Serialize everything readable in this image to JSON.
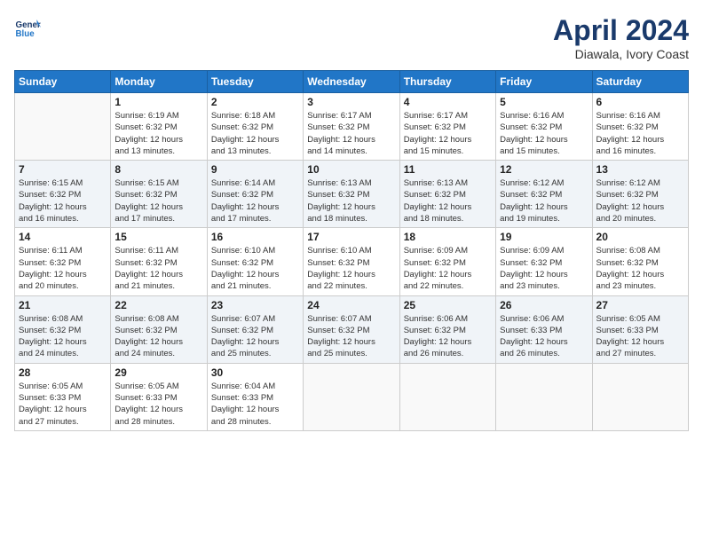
{
  "header": {
    "logo_line1": "General",
    "logo_line2": "Blue",
    "month": "April 2024",
    "location": "Diawala, Ivory Coast"
  },
  "weekdays": [
    "Sunday",
    "Monday",
    "Tuesday",
    "Wednesday",
    "Thursday",
    "Friday",
    "Saturday"
  ],
  "weeks": [
    [
      {
        "day": "",
        "info": ""
      },
      {
        "day": "1",
        "info": "Sunrise: 6:19 AM\nSunset: 6:32 PM\nDaylight: 12 hours\nand 13 minutes."
      },
      {
        "day": "2",
        "info": "Sunrise: 6:18 AM\nSunset: 6:32 PM\nDaylight: 12 hours\nand 13 minutes."
      },
      {
        "day": "3",
        "info": "Sunrise: 6:17 AM\nSunset: 6:32 PM\nDaylight: 12 hours\nand 14 minutes."
      },
      {
        "day": "4",
        "info": "Sunrise: 6:17 AM\nSunset: 6:32 PM\nDaylight: 12 hours\nand 15 minutes."
      },
      {
        "day": "5",
        "info": "Sunrise: 6:16 AM\nSunset: 6:32 PM\nDaylight: 12 hours\nand 15 minutes."
      },
      {
        "day": "6",
        "info": "Sunrise: 6:16 AM\nSunset: 6:32 PM\nDaylight: 12 hours\nand 16 minutes."
      }
    ],
    [
      {
        "day": "7",
        "info": "Sunrise: 6:15 AM\nSunset: 6:32 PM\nDaylight: 12 hours\nand 16 minutes."
      },
      {
        "day": "8",
        "info": "Sunrise: 6:15 AM\nSunset: 6:32 PM\nDaylight: 12 hours\nand 17 minutes."
      },
      {
        "day": "9",
        "info": "Sunrise: 6:14 AM\nSunset: 6:32 PM\nDaylight: 12 hours\nand 17 minutes."
      },
      {
        "day": "10",
        "info": "Sunrise: 6:13 AM\nSunset: 6:32 PM\nDaylight: 12 hours\nand 18 minutes."
      },
      {
        "day": "11",
        "info": "Sunrise: 6:13 AM\nSunset: 6:32 PM\nDaylight: 12 hours\nand 18 minutes."
      },
      {
        "day": "12",
        "info": "Sunrise: 6:12 AM\nSunset: 6:32 PM\nDaylight: 12 hours\nand 19 minutes."
      },
      {
        "day": "13",
        "info": "Sunrise: 6:12 AM\nSunset: 6:32 PM\nDaylight: 12 hours\nand 20 minutes."
      }
    ],
    [
      {
        "day": "14",
        "info": "Sunrise: 6:11 AM\nSunset: 6:32 PM\nDaylight: 12 hours\nand 20 minutes."
      },
      {
        "day": "15",
        "info": "Sunrise: 6:11 AM\nSunset: 6:32 PM\nDaylight: 12 hours\nand 21 minutes."
      },
      {
        "day": "16",
        "info": "Sunrise: 6:10 AM\nSunset: 6:32 PM\nDaylight: 12 hours\nand 21 minutes."
      },
      {
        "day": "17",
        "info": "Sunrise: 6:10 AM\nSunset: 6:32 PM\nDaylight: 12 hours\nand 22 minutes."
      },
      {
        "day": "18",
        "info": "Sunrise: 6:09 AM\nSunset: 6:32 PM\nDaylight: 12 hours\nand 22 minutes."
      },
      {
        "day": "19",
        "info": "Sunrise: 6:09 AM\nSunset: 6:32 PM\nDaylight: 12 hours\nand 23 minutes."
      },
      {
        "day": "20",
        "info": "Sunrise: 6:08 AM\nSunset: 6:32 PM\nDaylight: 12 hours\nand 23 minutes."
      }
    ],
    [
      {
        "day": "21",
        "info": "Sunrise: 6:08 AM\nSunset: 6:32 PM\nDaylight: 12 hours\nand 24 minutes."
      },
      {
        "day": "22",
        "info": "Sunrise: 6:08 AM\nSunset: 6:32 PM\nDaylight: 12 hours\nand 24 minutes."
      },
      {
        "day": "23",
        "info": "Sunrise: 6:07 AM\nSunset: 6:32 PM\nDaylight: 12 hours\nand 25 minutes."
      },
      {
        "day": "24",
        "info": "Sunrise: 6:07 AM\nSunset: 6:32 PM\nDaylight: 12 hours\nand 25 minutes."
      },
      {
        "day": "25",
        "info": "Sunrise: 6:06 AM\nSunset: 6:32 PM\nDaylight: 12 hours\nand 26 minutes."
      },
      {
        "day": "26",
        "info": "Sunrise: 6:06 AM\nSunset: 6:33 PM\nDaylight: 12 hours\nand 26 minutes."
      },
      {
        "day": "27",
        "info": "Sunrise: 6:05 AM\nSunset: 6:33 PM\nDaylight: 12 hours\nand 27 minutes."
      }
    ],
    [
      {
        "day": "28",
        "info": "Sunrise: 6:05 AM\nSunset: 6:33 PM\nDaylight: 12 hours\nand 27 minutes."
      },
      {
        "day": "29",
        "info": "Sunrise: 6:05 AM\nSunset: 6:33 PM\nDaylight: 12 hours\nand 28 minutes."
      },
      {
        "day": "30",
        "info": "Sunrise: 6:04 AM\nSunset: 6:33 PM\nDaylight: 12 hours\nand 28 minutes."
      },
      {
        "day": "",
        "info": ""
      },
      {
        "day": "",
        "info": ""
      },
      {
        "day": "",
        "info": ""
      },
      {
        "day": "",
        "info": ""
      }
    ]
  ]
}
